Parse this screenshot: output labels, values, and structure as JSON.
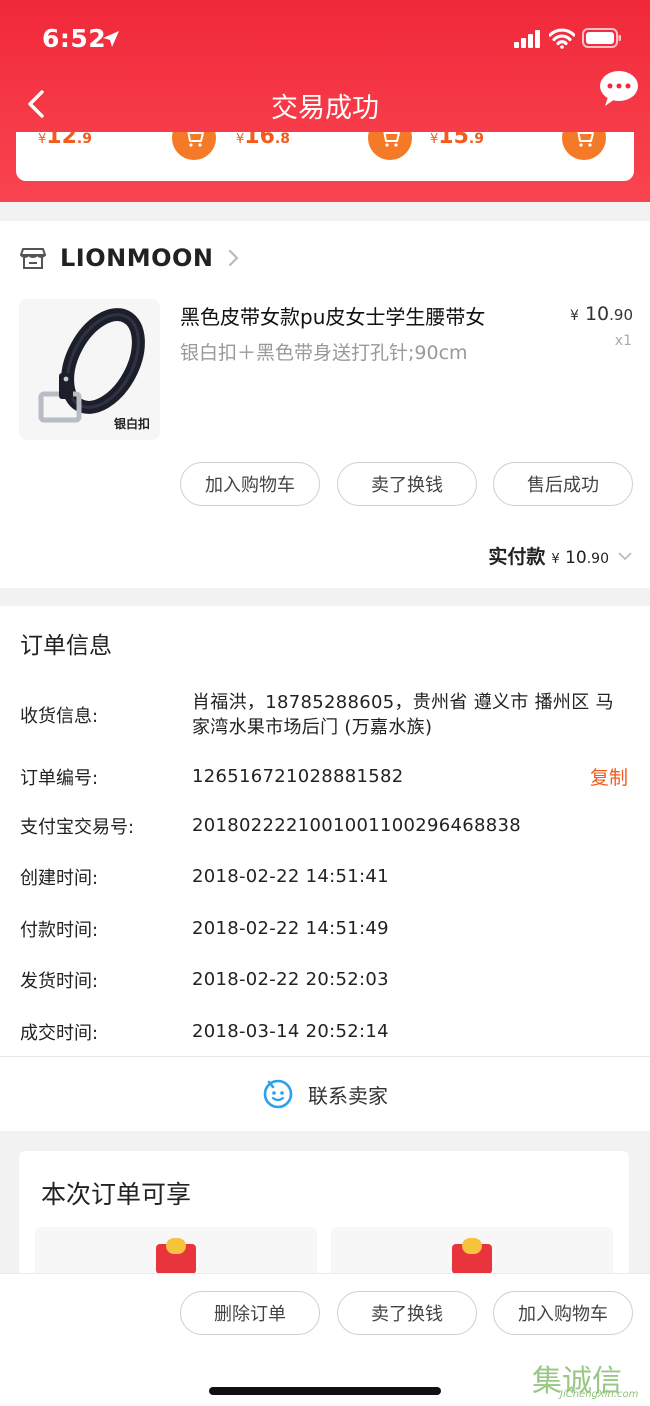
{
  "status_bar": {
    "time": "6:52"
  },
  "nav": {
    "title": "交易成功"
  },
  "recommendations": [
    {
      "currency": "¥",
      "int": "12",
      "dec": ".9"
    },
    {
      "currency": "¥",
      "int": "16",
      "dec": ".8"
    },
    {
      "currency": "¥",
      "int": "15",
      "dec": ".9"
    }
  ],
  "shop": {
    "name": "LIONMOON"
  },
  "product": {
    "title": "黑色皮带女款pu皮女士学生腰带女",
    "sku": "银白扣＋黑色带身送打孔针;90cm",
    "price_currency": "¥",
    "price_int": "10",
    "price_dec": ".90",
    "quantity": "x1",
    "image_tag": "银白扣"
  },
  "item_actions": [
    "加入购物车",
    "卖了换钱",
    "售后成功"
  ],
  "payment": {
    "label": "实付款",
    "currency": "¥",
    "int": "10",
    "dec": ".90"
  },
  "order_info": {
    "title": "订单信息",
    "rows": [
      {
        "label": "收货信息:",
        "value": "肖福洪，18785288605，贵州省 遵义市 播州区 马家湾水果市场后门 (万嘉水族)"
      },
      {
        "label": "订单编号:",
        "value": "126516721028881582"
      },
      {
        "label": "支付宝交易号:",
        "value": "2018022221001001100296468838"
      },
      {
        "label": "创建时间:",
        "value": "2018-02-22 14:51:41"
      },
      {
        "label": "付款时间:",
        "value": "2018-02-22 14:51:49"
      },
      {
        "label": "发货时间:",
        "value": "2018-02-22 20:52:03"
      },
      {
        "label": "成交时间:",
        "value": "2018-03-14 20:52:14"
      }
    ],
    "copy_label": "复制",
    "contact_label": "联系卖家"
  },
  "benefits": {
    "title": "本次订单可享"
  },
  "bottom_actions": [
    "删除订单",
    "卖了换钱",
    "加入购物车"
  ],
  "watermark": {
    "zh": "集诚信",
    "en": "JiChengXin.com"
  },
  "colors": {
    "header_red": "#f0283a",
    "accent_orange": "#f25b1d",
    "cart_orange": "#f57a28"
  }
}
